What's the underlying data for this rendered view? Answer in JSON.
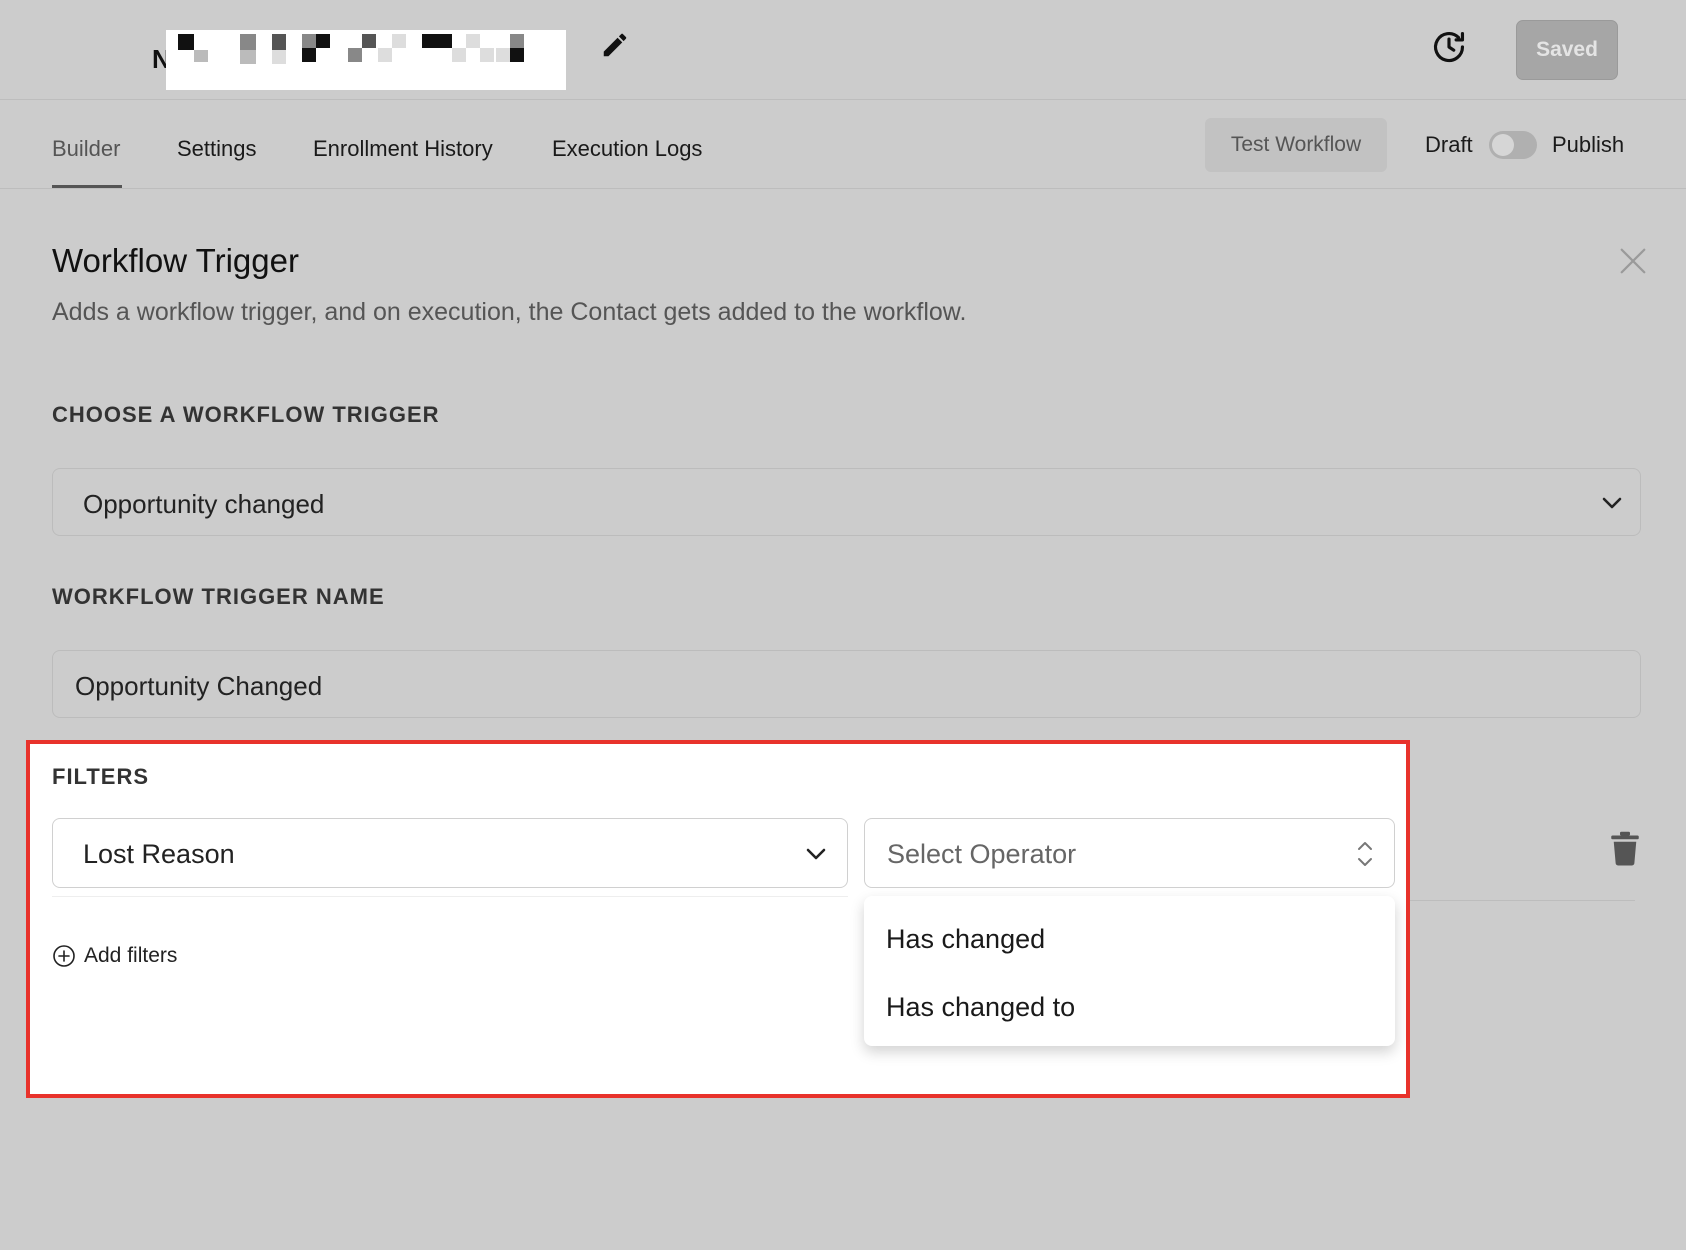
{
  "header": {
    "workflow_title": "N",
    "saved_label": "Saved"
  },
  "tabs": [
    {
      "label": "Builder"
    },
    {
      "label": "Settings"
    },
    {
      "label": "Enrollment History"
    },
    {
      "label": "Execution Logs"
    }
  ],
  "actions": {
    "test_workflow": "Test Workflow",
    "draft": "Draft",
    "publish": "Publish",
    "published": false
  },
  "panel": {
    "title": "Workflow Trigger",
    "subtitle": "Adds a workflow trigger, and on execution, the Contact gets added to the workflow.",
    "trigger_label": "CHOOSE A WORKFLOW TRIGGER",
    "trigger_value": "Opportunity changed",
    "name_label": "WORKFLOW TRIGGER NAME",
    "name_value": "Opportunity Changed",
    "filters_label": "FILTERS",
    "filter_field": "Lost Reason",
    "operator_placeholder": "Select Operator",
    "operator_options": [
      "Has changed",
      "Has changed to"
    ],
    "add_filters": "Add filters"
  },
  "colors": {
    "highlight_border": "#e8322b",
    "overlay_gray": "#cccccc"
  }
}
